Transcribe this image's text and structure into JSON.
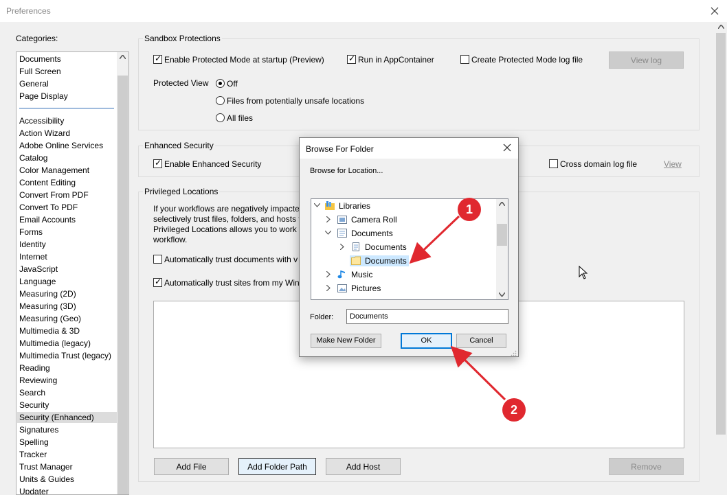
{
  "window": {
    "title": "Preferences"
  },
  "categories": {
    "label": "Categories:",
    "top_items": [
      "Documents",
      "Full Screen",
      "General",
      "Page Display"
    ],
    "items": [
      "Accessibility",
      "Action Wizard",
      "Adobe Online Services",
      "Catalog",
      "Color Management",
      "Content Editing",
      "Convert From PDF",
      "Convert To PDF",
      "Email Accounts",
      "Forms",
      "Identity",
      "Internet",
      "JavaScript",
      "Language",
      "Measuring (2D)",
      "Measuring (3D)",
      "Measuring (Geo)",
      "Multimedia & 3D",
      "Multimedia (legacy)",
      "Multimedia Trust (legacy)",
      "Reading",
      "Reviewing",
      "Search",
      "Security",
      "Security (Enhanced)",
      "Signatures",
      "Spelling",
      "Tracker",
      "Trust Manager",
      "Units & Guides",
      "Updater"
    ],
    "selected": "Security (Enhanced)"
  },
  "sandbox": {
    "title": "Sandbox Protections",
    "enable_protected_mode": "Enable Protected Mode at startup (Preview)",
    "run_in_appcontainer": "Run in AppContainer",
    "create_log": "Create Protected Mode log file",
    "view_log": "View log",
    "protected_view_label": "Protected View",
    "pv_off": "Off",
    "pv_unsafe": "Files from potentially unsafe locations",
    "pv_all": "All files"
  },
  "enhanced": {
    "title": "Enhanced Security",
    "enable": "Enable Enhanced Security",
    "cross_domain": "Cross domain log file",
    "view": "View"
  },
  "privileged": {
    "title": "Privileged Locations",
    "desc_lines": [
      "If your workflows are negatively impacte",
      "selectively trust files, folders, and hosts t",
      "Privileged Locations allows you to work s",
      "workflow."
    ],
    "auto_trust_docs": "Automatically trust documents with v",
    "auto_trust_sites": "Automatically trust sites from my Win",
    "add_file": "Add File",
    "add_folder": "Add Folder Path",
    "add_host": "Add Host",
    "remove": "Remove"
  },
  "dialog": {
    "title": "Browse For Folder",
    "subtitle": "Browse for Location...",
    "tree": [
      {
        "label": "Libraries"
      },
      {
        "label": "Camera Roll"
      },
      {
        "label": "Documents"
      },
      {
        "label": "Documents"
      },
      {
        "label": "Documents"
      },
      {
        "label": "Music"
      },
      {
        "label": "Pictures"
      }
    ],
    "folder_label": "Folder:",
    "folder_value": "Documents",
    "make_new_folder": "Make New Folder",
    "ok": "OK",
    "cancel": "Cancel"
  },
  "callouts": [
    "1",
    "2"
  ],
  "colors": {
    "callout": "#e0282f",
    "selection": "#cce8ff",
    "focus": "#0078d7"
  }
}
